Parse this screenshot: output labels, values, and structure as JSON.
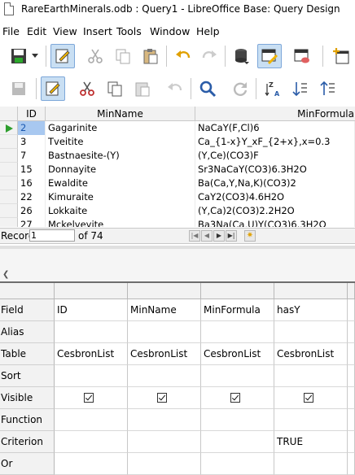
{
  "window": {
    "title": "RareEarthMinerals.odb : Query1 - LibreOffice Base: Query Design"
  },
  "menu": [
    "File",
    "Edit",
    "View",
    "Insert",
    "Tools",
    "Window",
    "Help"
  ],
  "toolbar1": {
    "icons": [
      "save-icon",
      "dropdown-arrow-icon",
      "edit-mode-icon",
      "cut-icon",
      "copy-icon",
      "paste-icon",
      "undo-icon",
      "redo-icon",
      "database-icon",
      "design-view-icon",
      "sql-run-icon",
      "clear-query-icon",
      "add-tables-icon"
    ]
  },
  "toolbar2": {
    "icons": [
      "save-record-icon",
      "edit-data-icon",
      "cut-icon",
      "copy-icon",
      "paste-icon",
      "undo-icon",
      "find-icon",
      "refresh-icon",
      "sort-icon",
      "sort-ascending-icon",
      "sort-descending-icon"
    ]
  },
  "result_grid": {
    "columns": [
      "ID",
      "MinName",
      "MinFormula"
    ],
    "rows": [
      {
        "id": "2",
        "name": "Gagarinite",
        "formula": "NaCaY(F,Cl)6",
        "current": true
      },
      {
        "id": "3",
        "name": "Tveitite",
        "formula": "Ca_{1-x}Y_xF_{2+x},x=0.3"
      },
      {
        "id": "7",
        "name": "Bastnaesite-(Y)",
        "formula": "(Y,Ce)(CO3)F"
      },
      {
        "id": "15",
        "name": "Donnayite",
        "formula": "Sr3NaCaY(CO3)6.3H2O"
      },
      {
        "id": "16",
        "name": "Ewaldite",
        "formula": "Ba(Ca,Y,Na,K)(CO3)2"
      },
      {
        "id": "22",
        "name": "Kimuraite",
        "formula": "CaY2(CO3)4.6H2O"
      },
      {
        "id": "26",
        "name": "Lokkaite",
        "formula": "(Y,Ca)2(CO3)2.2H2O"
      },
      {
        "id": "27",
        "name": "Mckelveyite",
        "formula": "Ba3Na(Ca,U)Y(CO3)6.3H2O"
      }
    ]
  },
  "navigation": {
    "record_label": "Record",
    "record_value": "1",
    "of_label": "of 74"
  },
  "design_grid": {
    "row_labels": [
      "Field",
      "Alias",
      "Table",
      "Sort",
      "Visible",
      "Function",
      "Criterion",
      "Or"
    ],
    "columns": [
      {
        "field": "ID",
        "table": "CesbronList",
        "visible": true,
        "criterion": ""
      },
      {
        "field": "MinName",
        "table": "CesbronList",
        "visible": true,
        "criterion": ""
      },
      {
        "field": "MinFormula",
        "table": "CesbronList",
        "visible": true,
        "criterion": ""
      },
      {
        "field": "hasY",
        "table": "CesbronList",
        "visible": true,
        "criterion": "TRUE"
      }
    ]
  },
  "colors": {
    "active_toolbar_bg": "#c9dff3",
    "current_row_arrow": "#2e9e2e",
    "selection_highlight": "#a8c8f0"
  }
}
